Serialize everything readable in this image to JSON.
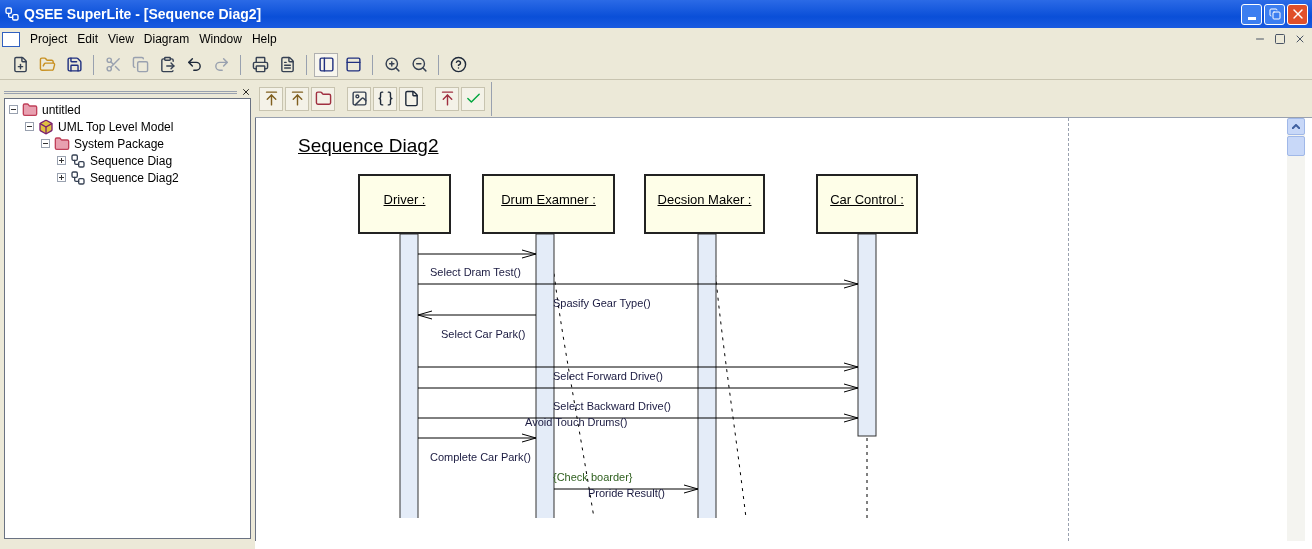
{
  "window": {
    "title": "QSEE SuperLite - [Sequence Diag2]"
  },
  "menu": [
    "Project",
    "Edit",
    "View",
    "Diagram",
    "Window",
    "Help"
  ],
  "tree": [
    {
      "label": "untitled",
      "kind": "folder",
      "expanded": true,
      "children": [
        {
          "label": "UML Top Level Model",
          "kind": "model",
          "expanded": true,
          "children": [
            {
              "label": "System Package",
              "kind": "folder",
              "expanded": true,
              "children": [
                {
                  "label": "Sequence Diag",
                  "kind": "diagram",
                  "expanded": false
                },
                {
                  "label": "Sequence Diag2",
                  "kind": "diagram",
                  "expanded": false
                }
              ]
            }
          ]
        }
      ]
    }
  ],
  "diagram": {
    "title": "Sequence Diag2",
    "actors": [
      "Driver :",
      "Drum Examner :",
      "Decsion Maker :",
      "Car Control :"
    ],
    "messages": [
      {
        "kind": "call",
        "label": "Select Dram Test()"
      },
      {
        "kind": "call",
        "label": "Spasify Gear Type()"
      },
      {
        "kind": "call",
        "label": "Select Car Park()"
      },
      {
        "kind": "call",
        "label": "Select Forward Drive()"
      },
      {
        "kind": "call",
        "label": "Select Backward Drive()"
      },
      {
        "kind": "call",
        "label": "Avoid Touch Drums()"
      },
      {
        "kind": "call",
        "label": "Complete Car Park()"
      },
      {
        "kind": "constraint",
        "label": "{Check boarder}"
      },
      {
        "kind": "call",
        "label": "Proride Result()"
      }
    ]
  }
}
